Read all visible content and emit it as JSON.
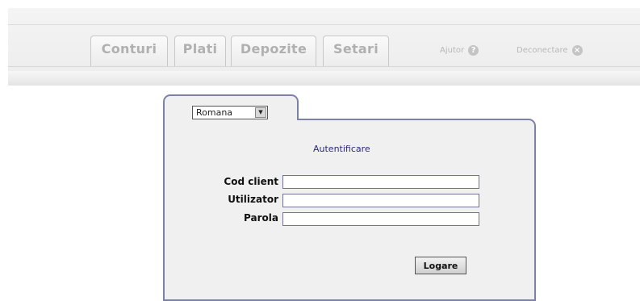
{
  "nav": {
    "tabs": [
      "Conturi",
      "Plati",
      "Depozite",
      "Setari"
    ],
    "help": {
      "label": "Ajutor",
      "icon": "?"
    },
    "logout": {
      "label": "Deconectare",
      "icon": "×"
    }
  },
  "login": {
    "language": "Romana",
    "title": "Autentificare",
    "fields": {
      "client_code": {
        "label": "Cod client",
        "value": ""
      },
      "username": {
        "label": "Utilizator",
        "value": ""
      },
      "password": {
        "label": "Parola",
        "value": ""
      }
    },
    "submit_label": "Logare"
  },
  "colors": {
    "panel_border": "#7c82a6",
    "panel_bg": "#f0f0f0",
    "heading": "#2a2a7a"
  }
}
